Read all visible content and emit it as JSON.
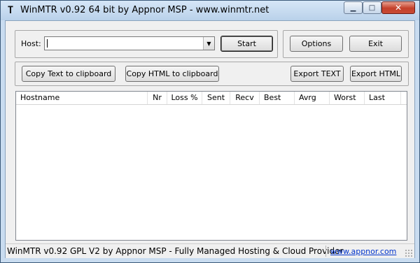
{
  "window": {
    "title": "WinMTR v0.92 64 bit by Appnor MSP - www.winmtr.net",
    "app_icon": "T",
    "controls": {
      "minimize": "▁",
      "maximize": "□",
      "close": "✕"
    }
  },
  "host": {
    "label": "Host:",
    "value": "",
    "placeholder": ""
  },
  "buttons": {
    "start": "Start",
    "options": "Options",
    "exit": "Exit",
    "copy_text": "Copy Text to clipboard",
    "copy_html": "Copy HTML to clipboard",
    "export_text": "Export TEXT",
    "export_html": "Export HTML"
  },
  "table": {
    "columns": [
      "Hostname",
      "Nr",
      "Loss %",
      "Sent",
      "Recv",
      "Best",
      "Avrg",
      "Worst",
      "Last"
    ],
    "rows": []
  },
  "statusbar": {
    "text": "WinMTR v0.92 GPL V2 by Appnor MSP - Fully Managed Hosting & Cloud Provider",
    "link": "www.appnor.com"
  }
}
